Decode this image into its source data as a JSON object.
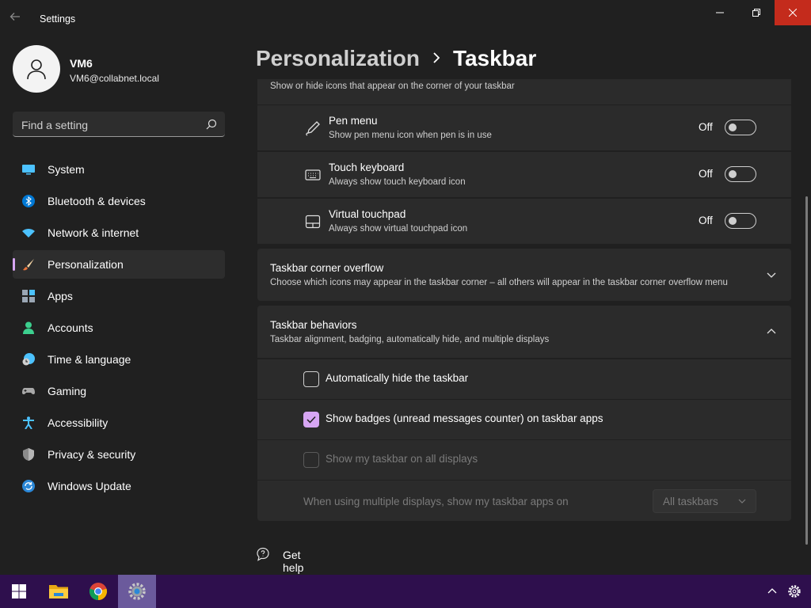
{
  "window": {
    "title": "Settings"
  },
  "profile": {
    "name": "VM6",
    "email": "VM6@collabnet.local"
  },
  "search": {
    "placeholder": "Find a setting"
  },
  "nav": [
    {
      "label": "System",
      "icon": "monitor-icon"
    },
    {
      "label": "Bluetooth & devices",
      "icon": "bluetooth-icon"
    },
    {
      "label": "Network & internet",
      "icon": "wifi-icon"
    },
    {
      "label": "Personalization",
      "icon": "brush-icon",
      "active": true
    },
    {
      "label": "Apps",
      "icon": "apps-icon"
    },
    {
      "label": "Accounts",
      "icon": "person-icon"
    },
    {
      "label": "Time & language",
      "icon": "clock-globe-icon"
    },
    {
      "label": "Gaming",
      "icon": "gamepad-icon"
    },
    {
      "label": "Accessibility",
      "icon": "accessibility-icon"
    },
    {
      "label": "Privacy & security",
      "icon": "shield-icon"
    },
    {
      "label": "Windows Update",
      "icon": "update-icon"
    }
  ],
  "breadcrumb": {
    "parent": "Personalization",
    "current": "Taskbar"
  },
  "corner_icons": {
    "description": "Show or hide icons that appear on the corner of your taskbar",
    "items": [
      {
        "title": "Pen menu",
        "subtitle": "Show pen menu icon when pen is in use",
        "state": "Off",
        "icon": "pen-icon"
      },
      {
        "title": "Touch keyboard",
        "subtitle": "Always show touch keyboard icon",
        "state": "Off",
        "icon": "keyboard-icon"
      },
      {
        "title": "Virtual touchpad",
        "subtitle": "Always show virtual touchpad icon",
        "state": "Off",
        "icon": "touchpad-icon"
      }
    ]
  },
  "overflow": {
    "title": "Taskbar corner overflow",
    "subtitle": "Choose which icons may appear in the taskbar corner – all others will appear in the taskbar corner overflow menu"
  },
  "behaviors": {
    "title": "Taskbar behaviors",
    "subtitle": "Taskbar alignment, badging, automatically hide, and multiple displays",
    "auto_hide": "Automatically hide the taskbar",
    "badges": "Show badges (unread messages counter) on taskbar apps",
    "all_displays": "Show my taskbar on all displays",
    "multi_display_label": "When using multiple displays, show my taskbar apps on",
    "multi_display_value": "All taskbars"
  },
  "help": {
    "label": "Get help"
  },
  "colors": {
    "accent": "#d7a6f3",
    "close": "#c42b1c",
    "taskbar": "#2e0f4d"
  }
}
